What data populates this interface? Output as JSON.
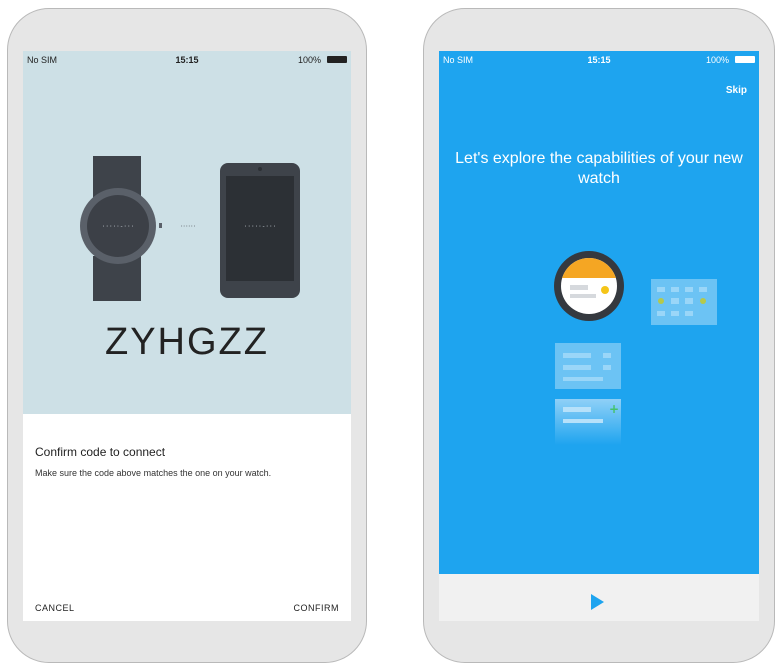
{
  "left_screen": {
    "status": {
      "carrier": "No SIM",
      "time": "15:15",
      "battery": "100%"
    },
    "pairing_code": "ZYHGZZ",
    "confirm": {
      "title": "Confirm code to connect",
      "description": "Make sure the code above matches the one on your watch."
    },
    "buttons": {
      "cancel": "CANCEL",
      "confirm": "CONFIRM"
    }
  },
  "right_screen": {
    "status": {
      "carrier": "No SIM",
      "time": "15:15",
      "battery": "100%"
    },
    "skip_label": "Skip",
    "headline": "Let's explore the capabilities of your new watch",
    "play_icon": "play-icon"
  },
  "colors": {
    "pairing_background": "#cde0e6",
    "intro_blue": "#1ea4ef",
    "watch_accent": "#f5a623",
    "dark_device": "#4a4f57"
  }
}
